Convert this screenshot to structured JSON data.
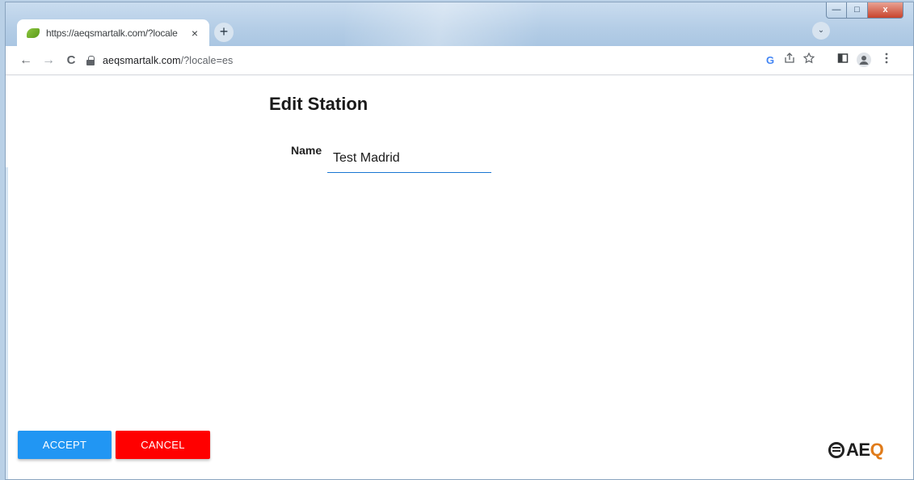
{
  "browser": {
    "tab_title": "https://aeqsmartalk.com/?locale",
    "tab_close": "×",
    "new_tab": "+",
    "tab_search": "⌄",
    "url_host": "aeqsmartalk.com",
    "url_rest": "/?locale=es",
    "nav": {
      "back": "←",
      "forward": "→",
      "reload": "C"
    },
    "toolbar_icons": [
      "G",
      "share-icon",
      "star-icon",
      "sidepanel-icon",
      "profile-icon",
      "menu-icon"
    ],
    "window_controls": {
      "minimize": "—",
      "maximize": "□",
      "close": "x"
    }
  },
  "page": {
    "title": "Edit Station",
    "name_label": "Name",
    "name_value": "Test Madrid"
  },
  "actions": {
    "accept_label": "ACCEPT",
    "cancel_label": "CANCEL"
  },
  "logo": {
    "text_main": "AE",
    "text_accent": "Q"
  },
  "colors": {
    "accept": "#2196f3",
    "cancel": "#ff0000",
    "field_underline": "#1976d2",
    "logo_accent": "#e07b1a"
  }
}
